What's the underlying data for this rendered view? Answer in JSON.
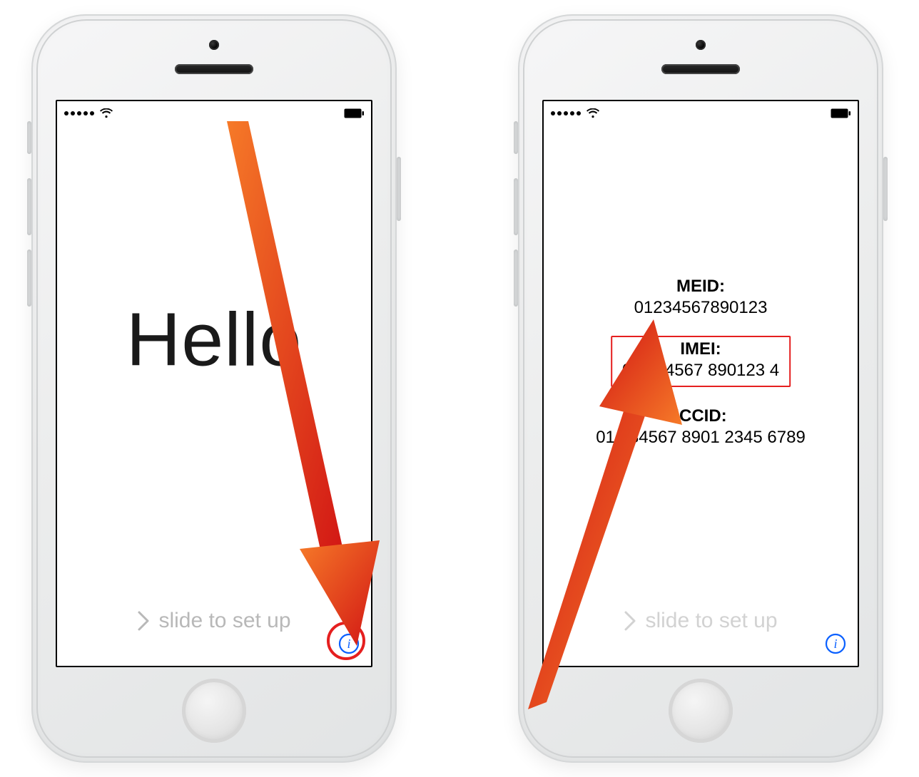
{
  "phone_left": {
    "greeting": "Hello",
    "slide_label": "slide to set up"
  },
  "phone_right": {
    "meid_label": "MEID:",
    "meid_value": "01234567890123",
    "imei_label": "IMEI:",
    "imei_value": "01 234567 890123 4",
    "iccid_label": "ICCID:",
    "iccid_value": "01 234567 8901 2345 6789",
    "slide_label": "slide to set up"
  },
  "icons": {
    "info": "info-icon",
    "wifi": "wifi-icon",
    "battery": "battery-icon",
    "signal": "signal-dots",
    "chevron": "chevron-right-icon"
  },
  "colors": {
    "highlight_red": "#e51f1f",
    "ios_blue": "#0a60ff"
  }
}
